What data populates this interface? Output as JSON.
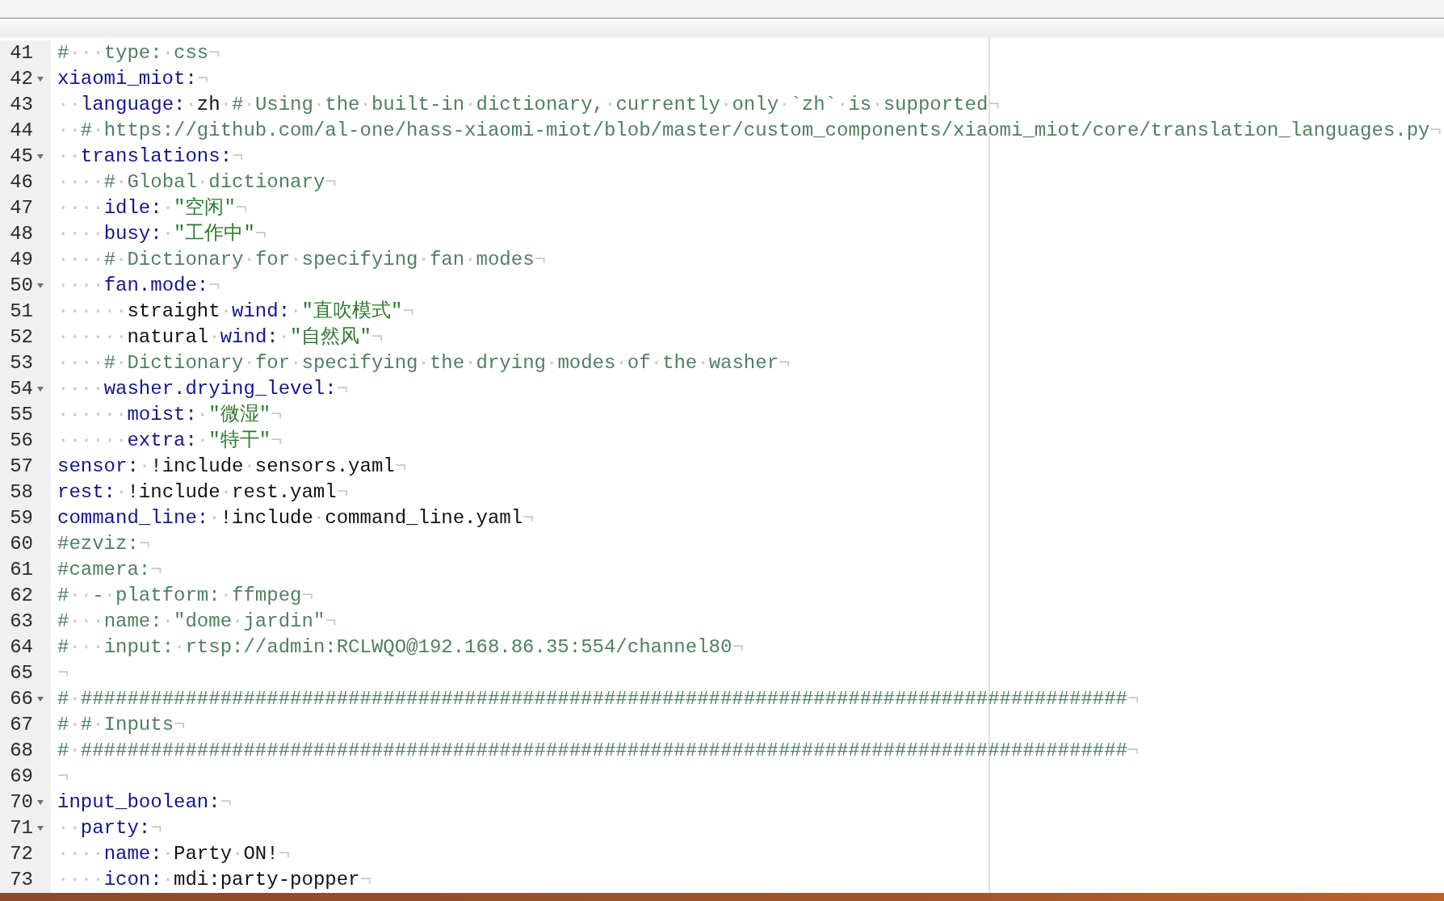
{
  "editor": {
    "lines": [
      {
        "number": "41",
        "fold": false,
        "tokens": [
          {
            "kind": "comment",
            "text": "#···type:·css"
          },
          {
            "kind": "eol",
            "text": "¬"
          }
        ]
      },
      {
        "number": "42",
        "fold": true,
        "tokens": [
          {
            "kind": "key",
            "text": "xiaomi_miot:"
          },
          {
            "kind": "eol",
            "text": "¬"
          }
        ]
      },
      {
        "number": "43",
        "fold": false,
        "tokens": [
          {
            "kind": "key",
            "text": "··language:"
          },
          {
            "kind": "plain",
            "text": "·zh·"
          },
          {
            "kind": "comment",
            "text": "#·Using·the·built-in·dictionary,·currently·only·`zh`·is·supported"
          },
          {
            "kind": "eol",
            "text": "¬"
          }
        ]
      },
      {
        "number": "44",
        "fold": false,
        "tokens": [
          {
            "kind": "comment",
            "text": "··#·https://github.com/al-one/hass-xiaomi-miot/blob/master/custom_components/xiaomi_miot/core/translation_languages.py"
          },
          {
            "kind": "eol",
            "text": "¬"
          }
        ]
      },
      {
        "number": "45",
        "fold": true,
        "tokens": [
          {
            "kind": "key",
            "text": "··translations:"
          },
          {
            "kind": "eol",
            "text": "¬"
          }
        ]
      },
      {
        "number": "46",
        "fold": false,
        "tokens": [
          {
            "kind": "comment",
            "text": "····#·Global·dictionary"
          },
          {
            "kind": "eol",
            "text": "¬"
          }
        ]
      },
      {
        "number": "47",
        "fold": false,
        "tokens": [
          {
            "kind": "key",
            "text": "····idle:"
          },
          {
            "kind": "string",
            "text": "·\"空闲\""
          },
          {
            "kind": "eol",
            "text": "¬"
          }
        ]
      },
      {
        "number": "48",
        "fold": false,
        "tokens": [
          {
            "kind": "key",
            "text": "····busy:"
          },
          {
            "kind": "string",
            "text": "·\"工作中\""
          },
          {
            "kind": "eol",
            "text": "¬"
          }
        ]
      },
      {
        "number": "49",
        "fold": false,
        "tokens": [
          {
            "kind": "comment",
            "text": "····#·Dictionary·for·specifying·fan·modes"
          },
          {
            "kind": "eol",
            "text": "¬"
          }
        ]
      },
      {
        "number": "50",
        "fold": true,
        "tokens": [
          {
            "kind": "key",
            "text": "····fan.mode:"
          },
          {
            "kind": "eol",
            "text": "¬"
          }
        ]
      },
      {
        "number": "51",
        "fold": false,
        "tokens": [
          {
            "kind": "plain",
            "text": "······straight·"
          },
          {
            "kind": "key",
            "text": "wind:"
          },
          {
            "kind": "string",
            "text": "·\"直吹模式\""
          },
          {
            "kind": "eol",
            "text": "¬"
          }
        ]
      },
      {
        "number": "52",
        "fold": false,
        "tokens": [
          {
            "kind": "plain",
            "text": "······natural·"
          },
          {
            "kind": "key",
            "text": "wind:"
          },
          {
            "kind": "string",
            "text": "·\"自然风\""
          },
          {
            "kind": "eol",
            "text": "¬"
          }
        ]
      },
      {
        "number": "53",
        "fold": false,
        "tokens": [
          {
            "kind": "comment",
            "text": "····#·Dictionary·for·specifying·the·drying·modes·of·the·washer"
          },
          {
            "kind": "eol",
            "text": "¬"
          }
        ]
      },
      {
        "number": "54",
        "fold": true,
        "tokens": [
          {
            "kind": "key",
            "text": "····washer.drying_level:"
          },
          {
            "kind": "eol",
            "text": "¬"
          }
        ]
      },
      {
        "number": "55",
        "fold": false,
        "tokens": [
          {
            "kind": "key",
            "text": "······moist:"
          },
          {
            "kind": "string",
            "text": "·\"微湿\""
          },
          {
            "kind": "eol",
            "text": "¬"
          }
        ]
      },
      {
        "number": "56",
        "fold": false,
        "tokens": [
          {
            "kind": "key",
            "text": "······extra:"
          },
          {
            "kind": "string",
            "text": "·\"特干\""
          },
          {
            "kind": "eol",
            "text": "¬"
          }
        ]
      },
      {
        "number": "57",
        "fold": false,
        "tokens": [
          {
            "kind": "key",
            "text": "sensor:"
          },
          {
            "kind": "plain",
            "text": "·!include·sensors.yaml"
          },
          {
            "kind": "eol",
            "text": "¬"
          }
        ]
      },
      {
        "number": "58",
        "fold": false,
        "tokens": [
          {
            "kind": "key",
            "text": "rest:"
          },
          {
            "kind": "plain",
            "text": "·!include·rest.yaml"
          },
          {
            "kind": "eol",
            "text": "¬"
          }
        ]
      },
      {
        "number": "59",
        "fold": false,
        "tokens": [
          {
            "kind": "key",
            "text": "command_line:"
          },
          {
            "kind": "plain",
            "text": "·!include·command_line.yaml"
          },
          {
            "kind": "eol",
            "text": "¬"
          }
        ]
      },
      {
        "number": "60",
        "fold": false,
        "tokens": [
          {
            "kind": "comment",
            "text": "#ezviz:"
          },
          {
            "kind": "eol",
            "text": "¬"
          }
        ]
      },
      {
        "number": "61",
        "fold": false,
        "tokens": [
          {
            "kind": "comment",
            "text": "#camera:"
          },
          {
            "kind": "eol",
            "text": "¬"
          }
        ]
      },
      {
        "number": "62",
        "fold": false,
        "tokens": [
          {
            "kind": "comment",
            "text": "#··-·platform:·ffmpeg"
          },
          {
            "kind": "eol",
            "text": "¬"
          }
        ]
      },
      {
        "number": "63",
        "fold": false,
        "tokens": [
          {
            "kind": "comment",
            "text": "#···name:·\"dome·jardin\""
          },
          {
            "kind": "eol",
            "text": "¬"
          }
        ]
      },
      {
        "number": "64",
        "fold": false,
        "tokens": [
          {
            "kind": "comment",
            "text": "#···input:·rtsp://admin:RCLWQO@192.168.86.35:554/channel80"
          },
          {
            "kind": "eol",
            "text": "¬"
          }
        ]
      },
      {
        "number": "65",
        "fold": false,
        "tokens": [
          {
            "kind": "eol",
            "text": "¬"
          }
        ]
      },
      {
        "number": "66",
        "fold": true,
        "tokens": [
          {
            "kind": "comment",
            "text": "#·##########################################################################################"
          },
          {
            "kind": "eol",
            "text": "¬"
          }
        ]
      },
      {
        "number": "67",
        "fold": false,
        "tokens": [
          {
            "kind": "comment",
            "text": "#·#·Inputs"
          },
          {
            "kind": "eol",
            "text": "¬"
          }
        ]
      },
      {
        "number": "68",
        "fold": false,
        "tokens": [
          {
            "kind": "comment",
            "text": "#·##########################################################################################"
          },
          {
            "kind": "eol",
            "text": "¬"
          }
        ]
      },
      {
        "number": "69",
        "fold": false,
        "tokens": [
          {
            "kind": "eol",
            "text": "¬"
          }
        ]
      },
      {
        "number": "70",
        "fold": true,
        "tokens": [
          {
            "kind": "key",
            "text": "input_boolean:"
          },
          {
            "kind": "eol",
            "text": "¬"
          }
        ]
      },
      {
        "number": "71",
        "fold": true,
        "tokens": [
          {
            "kind": "key",
            "text": "··party:"
          },
          {
            "kind": "eol",
            "text": "¬"
          }
        ]
      },
      {
        "number": "72",
        "fold": false,
        "tokens": [
          {
            "kind": "key",
            "text": "····name:"
          },
          {
            "kind": "plain",
            "text": "·Party·ON!"
          },
          {
            "kind": "eol",
            "text": "¬"
          }
        ]
      },
      {
        "number": "73",
        "fold": false,
        "tokens": [
          {
            "kind": "key",
            "text": "····icon:"
          },
          {
            "kind": "plain",
            "text": "·mdi:party-popper"
          },
          {
            "kind": "eol",
            "text": "¬"
          }
        ]
      }
    ]
  }
}
